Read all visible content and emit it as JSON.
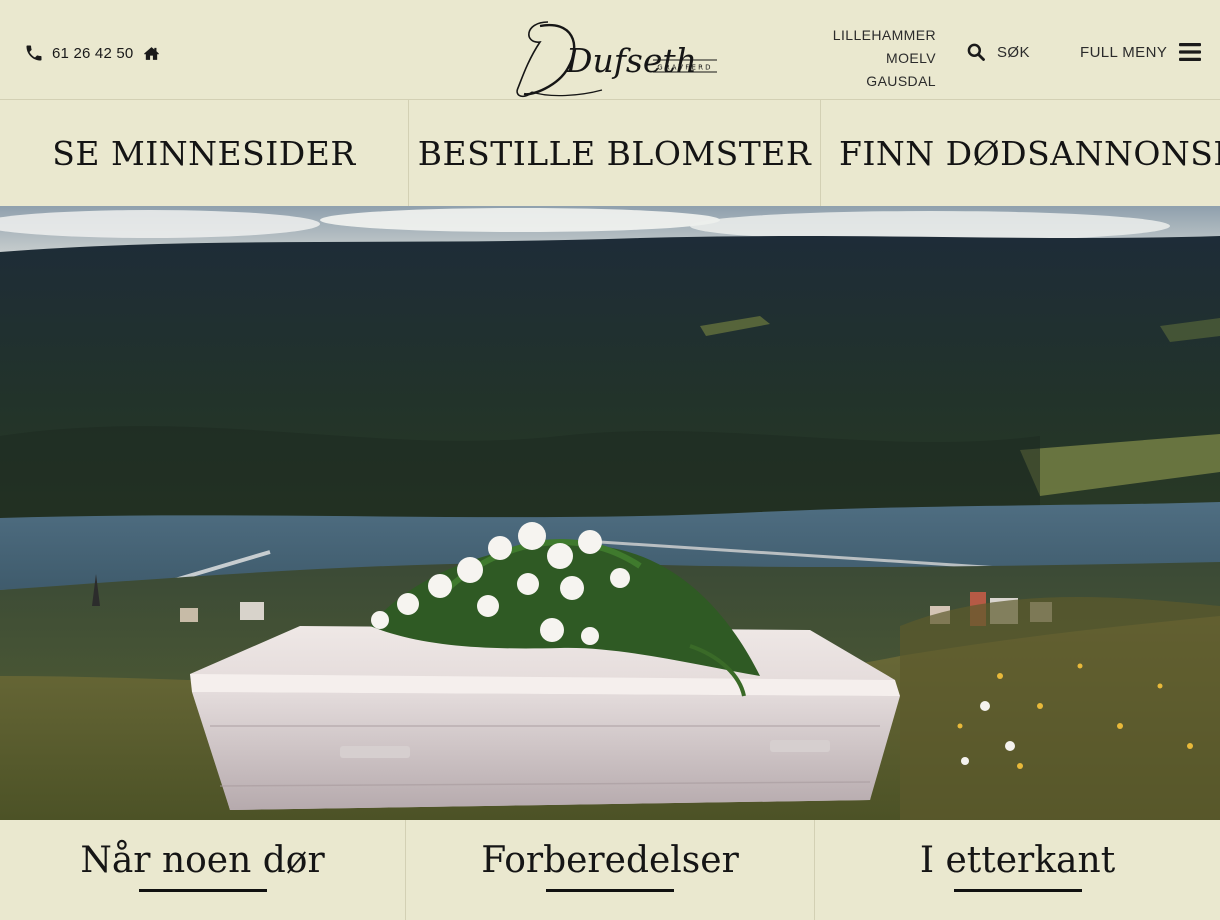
{
  "header": {
    "phone": "61 26 42 50",
    "logo_text": "Dufseth",
    "logo_subtext": "GRAVFERD",
    "places": [
      "LILLEHAMMER",
      "MOELV",
      "GAUSDAL"
    ],
    "search_label": "SØK",
    "menu_label": "FULL MENY"
  },
  "quick_links": [
    {
      "label": "SE MINNESIDER"
    },
    {
      "label": "BESTILLE BLOMSTER"
    },
    {
      "label": "FINN DØDSANNONSER"
    }
  ],
  "cards": [
    {
      "title": "Når noen dør"
    },
    {
      "title": "Forberedelser"
    },
    {
      "title": "I etterkant"
    }
  ],
  "colors": {
    "background": "#eae8cf",
    "divider": "#d3d0b4",
    "text": "#1c1c1c"
  },
  "icons": [
    "phone-icon",
    "home-icon",
    "search-icon",
    "hamburger-icon"
  ]
}
